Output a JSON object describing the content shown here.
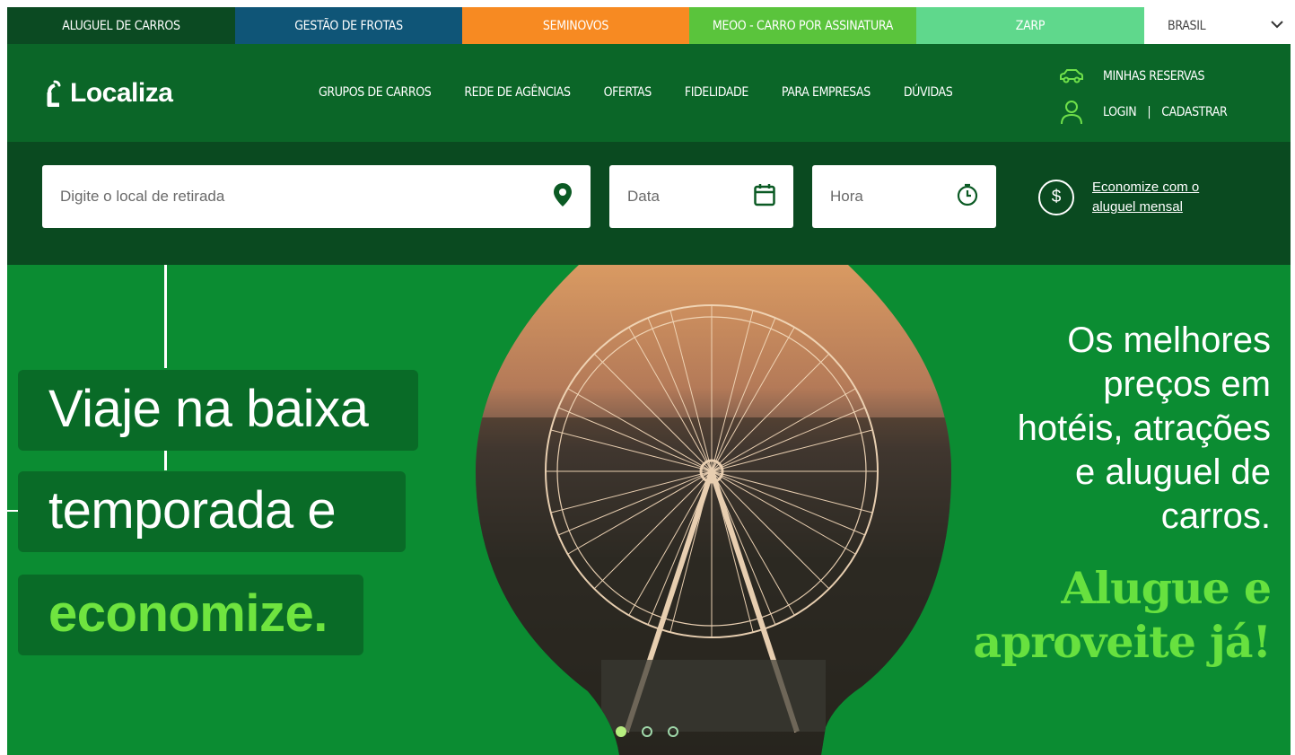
{
  "topbar": {
    "tabs": [
      "ALUGUEL DE CARROS",
      "GESTÃO DE FROTAS",
      "SEMINOVOS",
      "MEOO - CARRO POR ASSINATURA",
      "ZARP"
    ],
    "country": "BRASIL"
  },
  "header": {
    "logo": "Localiza",
    "nav": [
      "GRUPOS DE CARROS",
      "REDE DE AGÊNCIAS",
      "OFERTAS",
      "FIDELIDADE",
      "PARA EMPRESAS",
      "DÚVIDAS"
    ],
    "my_reservations": "MINHAS RESERVAS",
    "login": "LOGIN",
    "separator": "|",
    "register": "CADASTRAR"
  },
  "search": {
    "location_placeholder": "Digite o local de retirada",
    "date_placeholder": "Data",
    "time_placeholder": "Hora",
    "coin_symbol": "$",
    "monthly_link": "Economize com o aluguel mensal"
  },
  "hero": {
    "tagline": [
      "Viaje na baixa",
      "temporada e",
      "economize."
    ],
    "right_copy": [
      "Os melhores",
      "preços em",
      "hotéis, atrações",
      "e aluguel de",
      "carros."
    ],
    "cta": [
      "Alugue e",
      "aproveite já!"
    ],
    "slide_count": 3,
    "active_slide": 1
  },
  "colors": {
    "header_green": "#0b6628",
    "search_bg": "#0a4a20",
    "hero_green": "#0b8c32",
    "accent_lime": "#67e13f"
  }
}
